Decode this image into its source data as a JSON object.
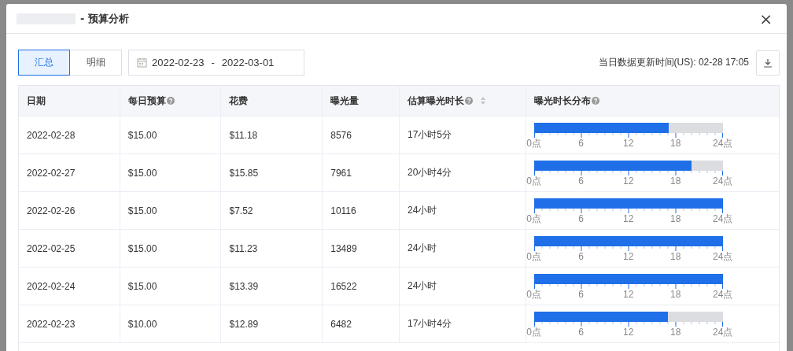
{
  "dialog": {
    "title": "- 预算分析",
    "close": "×"
  },
  "view_tabs": [
    {
      "label": "汇总",
      "selected": true
    },
    {
      "label": "明细",
      "selected": false
    }
  ],
  "date_range": {
    "start": "2022-02-23",
    "separator": "-",
    "end": "2022-03-01"
  },
  "update_time": "当日数据更新时间(US): 02-28 17:05",
  "table": {
    "columns": [
      {
        "label": "日期",
        "help": false,
        "sortable": false
      },
      {
        "label": "每日预算",
        "help": true,
        "sortable": false
      },
      {
        "label": "花费",
        "help": false,
        "sortable": false
      },
      {
        "label": "曝光量",
        "help": false,
        "sortable": false
      },
      {
        "label": "估算曝光时长",
        "help": true,
        "sortable": true
      },
      {
        "label": "曝光时长分布",
        "help": true,
        "sortable": false
      }
    ],
    "rows": [
      {
        "date": "2022-02-28",
        "budget": "$15.00",
        "spend": "$11.18",
        "impressions": "8576",
        "duration": "17小时5分",
        "level": 0.712,
        "axis": [
          "0点",
          "6",
          "12",
          "18",
          "24点"
        ]
      },
      {
        "date": "2022-02-27",
        "budget": "$15.00",
        "spend": "$15.85",
        "impressions": "7961",
        "duration": "20小时4分",
        "level": 0.836,
        "axis": [
          "0点",
          "6",
          "12",
          "18",
          "24点"
        ]
      },
      {
        "date": "2022-02-26",
        "budget": "$15.00",
        "spend": "$7.52",
        "impressions": "10116",
        "duration": "24小时",
        "level": 1,
        "axis": [
          "0点",
          "6",
          "12",
          "18",
          "24点"
        ]
      },
      {
        "date": "2022-02-25",
        "budget": "$15.00",
        "spend": "$11.23",
        "impressions": "13489",
        "duration": "24小时",
        "level": 1,
        "axis": [
          "0点",
          "6",
          "12",
          "18",
          "24点"
        ]
      },
      {
        "date": "2022-02-24",
        "budget": "$15.00",
        "spend": "$13.39",
        "impressions": "16522",
        "duration": "24小时",
        "level": 1,
        "axis": [
          "0点",
          "6",
          "12",
          "18",
          "24点"
        ]
      },
      {
        "date": "2022-02-23",
        "budget": "$10.00",
        "spend": "$12.89",
        "impressions": "6482",
        "duration": "17小时4分",
        "level": 0.711,
        "axis": [
          "0点",
          "6",
          "12",
          "18",
          "24点"
        ]
      }
    ]
  }
}
